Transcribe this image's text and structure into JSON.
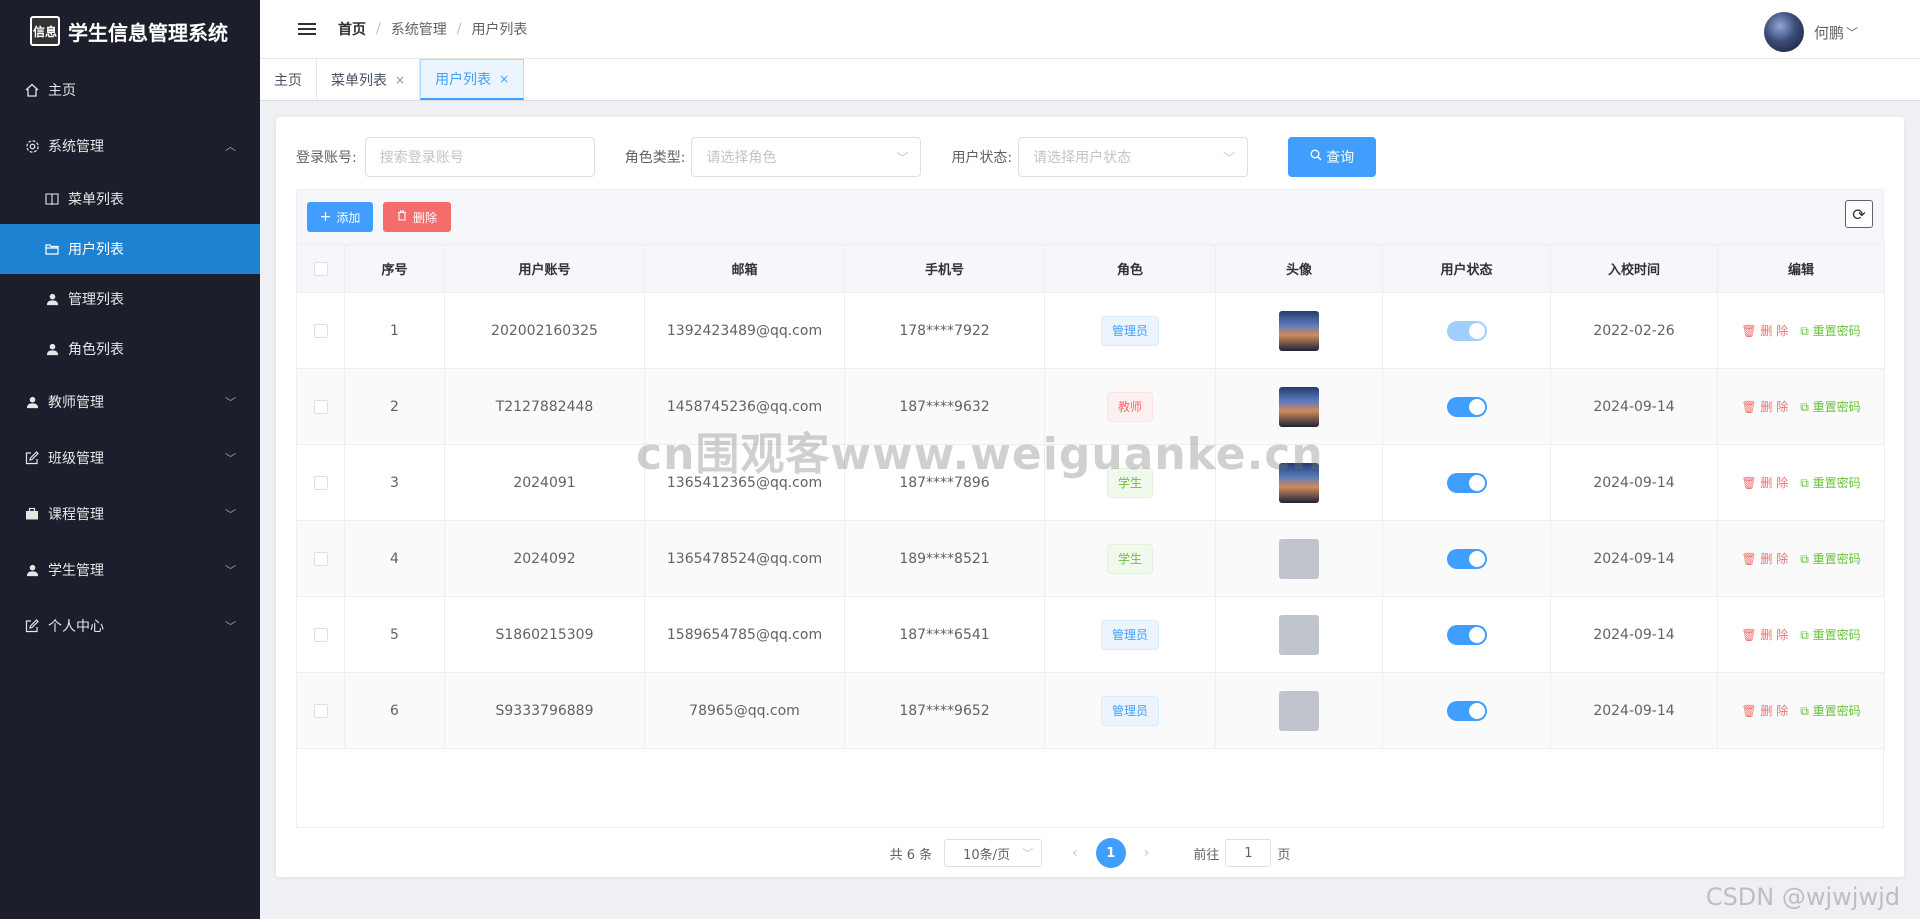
{
  "app": {
    "logo_text": "信息",
    "title": "学生信息管理系统"
  },
  "sidebar": {
    "items": [
      {
        "label": "主页",
        "icon": "home-icon"
      },
      {
        "label": "系统管理",
        "icon": "gear-icon",
        "expanded": true,
        "children": [
          {
            "label": "菜单列表",
            "icon": "book-icon"
          },
          {
            "label": "用户列表",
            "icon": "folder-icon",
            "active": true
          },
          {
            "label": "管理列表",
            "icon": "user-icon"
          },
          {
            "label": "角色列表",
            "icon": "user-icon"
          }
        ]
      },
      {
        "label": "教师管理",
        "icon": "user-icon"
      },
      {
        "label": "班级管理",
        "icon": "edit-icon"
      },
      {
        "label": "课程管理",
        "icon": "briefcase-icon"
      },
      {
        "label": "学生管理",
        "icon": "user-icon"
      },
      {
        "label": "个人中心",
        "icon": "edit-icon"
      }
    ]
  },
  "header": {
    "breadcrumb": [
      "首页",
      "系统管理",
      "用户列表"
    ],
    "sep": "/",
    "user_name": "何鹏"
  },
  "tabs": [
    {
      "label": "主页",
      "closable": false
    },
    {
      "label": "菜单列表",
      "closable": true
    },
    {
      "label": "用户列表",
      "closable": true,
      "active": true
    }
  ],
  "search": {
    "account_label": "登录账号:",
    "account_placeholder": "搜索登录账号",
    "role_label": "角色类型:",
    "role_placeholder": "请选择角色",
    "status_label": "用户状态:",
    "status_placeholder": "请选择用户状态",
    "query_label": "查询"
  },
  "toolbar": {
    "add_label": "添加",
    "delete_label": "删除"
  },
  "table": {
    "columns": [
      "序号",
      "用户账号",
      "邮箱",
      "手机号",
      "角色",
      "头像",
      "用户状态",
      "入校时间",
      "编辑"
    ],
    "rows": [
      {
        "no": "1",
        "account": "202002160325",
        "email": "1392423489@qq.com",
        "phone": "178****7922",
        "role": "管理员",
        "role_type": "admin",
        "avatar": "photo",
        "enabled": true,
        "date": "2022-02-26"
      },
      {
        "no": "2",
        "account": "T2127882448",
        "email": "1458745236@qq.com",
        "phone": "187****9632",
        "role": "教师",
        "role_type": "teacher",
        "avatar": "photo",
        "enabled": true,
        "date": "2024-09-14"
      },
      {
        "no": "3",
        "account": "2024091",
        "email": "1365412365@qq.com",
        "phone": "187****7896",
        "role": "学生",
        "role_type": "student",
        "avatar": "photo",
        "enabled": true,
        "date": "2024-09-14"
      },
      {
        "no": "4",
        "account": "2024092",
        "email": "1365478524@qq.com",
        "phone": "189****8521",
        "role": "学生",
        "role_type": "student",
        "avatar": "blank",
        "enabled": true,
        "date": "2024-09-14"
      },
      {
        "no": "5",
        "account": "S1860215309",
        "email": "1589654785@qq.com",
        "phone": "187****6541",
        "role": "管理员",
        "role_type": "admin",
        "avatar": "blank",
        "enabled": true,
        "date": "2024-09-14"
      },
      {
        "no": "6",
        "account": "S9333796889",
        "email": "78965@qq.com",
        "phone": "187****9652",
        "role": "管理员",
        "role_type": "admin",
        "avatar": "blank",
        "enabled": true,
        "date": "2024-09-14"
      }
    ],
    "delete_action": "删 除",
    "reset_action": "重置密码"
  },
  "pagination": {
    "total_text": "共 6 条",
    "page_size": "10条/页",
    "current_page": "1",
    "goto_label": "前往",
    "goto_value": "1",
    "page_suffix": "页"
  },
  "watermarks": {
    "center": "cn围观客www.weiguanke.cn",
    "corner": "CSDN @wjwjwjd"
  }
}
